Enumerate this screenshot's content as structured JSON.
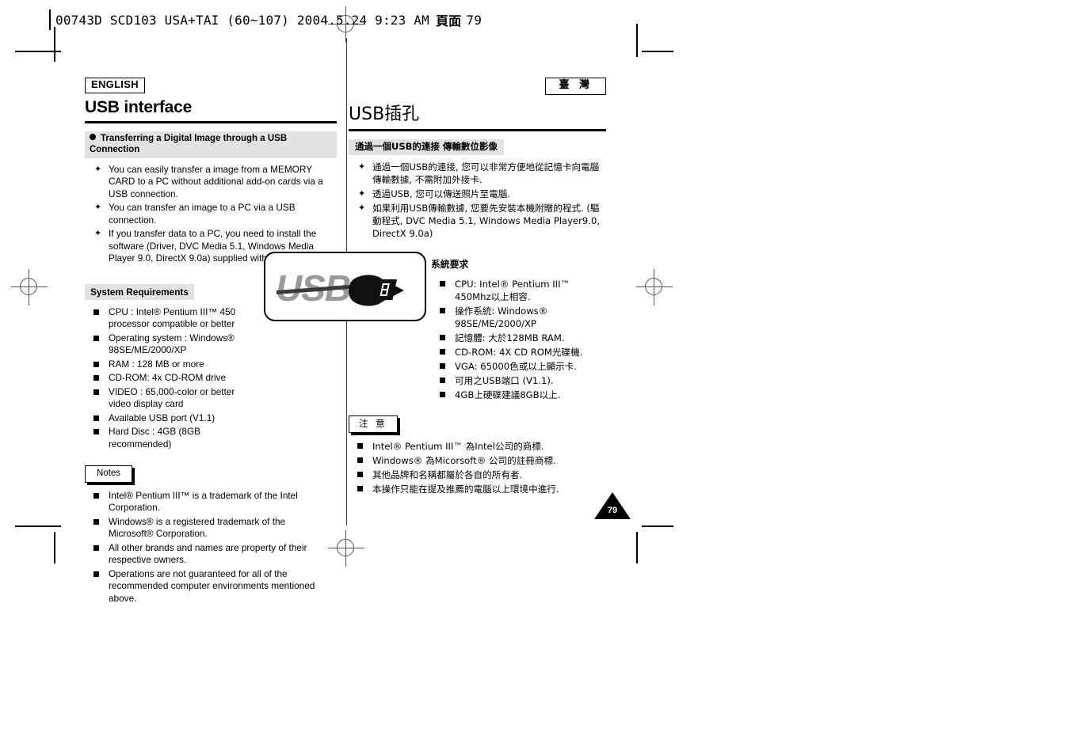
{
  "slug": {
    "text": "00743D SCD103 USA+TAI (60~107)   2004.5.24   9:23 AM",
    "cjk": "頁面",
    "page": "79"
  },
  "english": {
    "lang_tag": "ENGLISH",
    "title": "USB interface",
    "transfer_section": {
      "heading": "Transferring a Digital Image through a USB Connection",
      "items": [
        "You can easily transfer a image from a MEMORY CARD to a PC without additional add-on cards via a USB connection.",
        "You can transfer an image to a PC via a USB connection.",
        "If you transfer data to a PC, you need to install the software (Driver, DVC Media 5.1, Windows Media Player 9.0, DirectX 9.0a) supplied with the camcorder."
      ]
    },
    "requirements_section": {
      "heading": "System Requirements",
      "items": [
        "CPU : Intel® Pentium III™ 450 processor compatible or better",
        "Operating system : Windows® 98SE/ME/2000/XP",
        "RAM : 128 MB or more",
        "CD-ROM: 4x CD-ROM drive",
        "VIDEO : 65,000-color or better video display card",
        "Available USB port (V1.1)",
        "Hard Disc : 4GB (8GB recommended)"
      ]
    },
    "notes_section": {
      "heading": "Notes",
      "items": [
        "Intel® Pentium III™ is a trademark of the Intel Corporation.",
        "Windows® is a registered trademark of the Microsoft® Corporation.",
        "All other brands and names are property of their respective owners.",
        "Operations are not guaranteed for all of the recommended computer environments mentioned above."
      ]
    }
  },
  "taiwan": {
    "lang_tag": "臺 灣",
    "title": "USB插孔",
    "transfer_section": {
      "heading": "通過一個USB的連接 傳輸數位影像",
      "items": [
        "通過一個USB的連接, 您可以非常方便地從記憶卡向電腦傳輸數據, 不需附加外接卡.",
        "透過USB, 您可以傳送照片至電腦.",
        "如果利用USB傳輸數據, 您要先安裝本機附贈的程式. (驅動程式, DVC Media 5.1, Windows Media Player9.0, DirectX 9.0a)"
      ]
    },
    "requirements_section": {
      "heading": "系統要求",
      "items": [
        "CPU: Intel® Pentium III™ 450Mhz以上相容.",
        "操作系統: Windows® 98SE/ME/2000/XP",
        "記憶體: 大於128MB RAM.",
        "CD-ROM: 4X CD ROM光碟機.",
        "VGA: 65000色或以上顯示卡.",
        "可用之USB端口 (V1.1).",
        "4GB上硬碟建議8GB以上."
      ]
    },
    "notes_section": {
      "heading": "注 意",
      "items": [
        "Intel® Pentium III™ 為Intel公司的商標.",
        "Windows® 為Micorsoft® 公司的註冊商標.",
        "其他品牌和名稱都屬於各自的所有者.",
        "本操作只能在提及推薦的電腦以上環境中進行."
      ]
    }
  },
  "usb_logo": {
    "wordmark": "USB",
    "alt": "usb-logo"
  },
  "page_badge": {
    "number": "79"
  },
  "colors": {
    "ink": "#000000",
    "paper": "#ffffff",
    "section_band": "#e2e2e2",
    "logo_gray": "#9a9a9a",
    "mark_gray": "#555555"
  }
}
